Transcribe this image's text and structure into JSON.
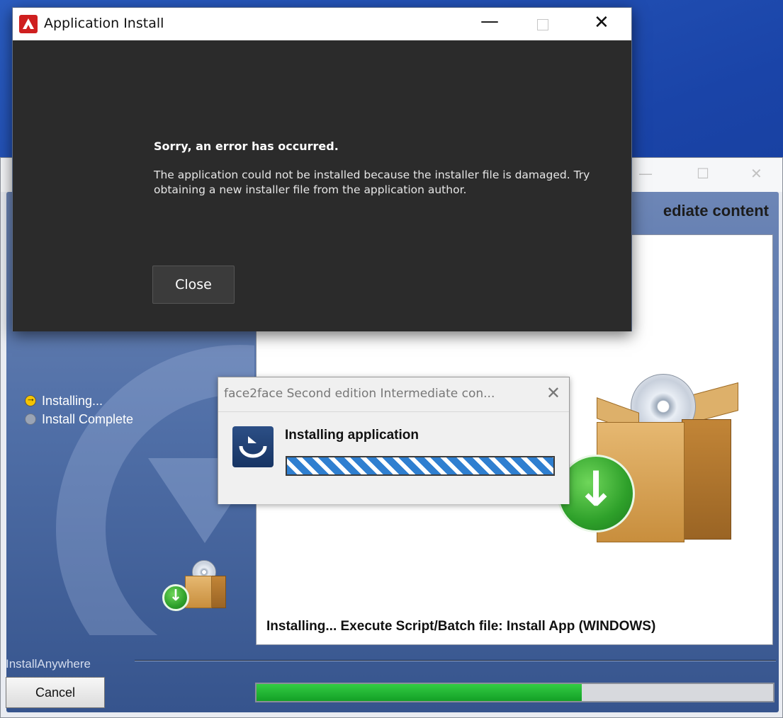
{
  "installer": {
    "header_text": "ediate content",
    "steps": [
      {
        "label": "Installing...",
        "state": "active"
      },
      {
        "label": "Install Complete",
        "state": "pending"
      }
    ],
    "status_text": "Installing...  Execute Script/Batch file: Install App (WINDOWS)",
    "footer_label": "InstallAnywhere",
    "cancel_label": "Cancel",
    "progress_percent": 63,
    "progress_color": "#13a026"
  },
  "install_dialog": {
    "title": "face2face Second edition Intermediate con...",
    "heading": "Installing application",
    "icon": "air-installer-icon"
  },
  "air_dialog": {
    "title": "Application Install",
    "heading": "Sorry, an error has occurred.",
    "message": "The application could not be installed because the installer file is damaged. Try obtaining a new installer file from the application author.",
    "close_label": "Close",
    "logo": "adobe-air-logo",
    "logo_color": "#cf1f1f"
  }
}
